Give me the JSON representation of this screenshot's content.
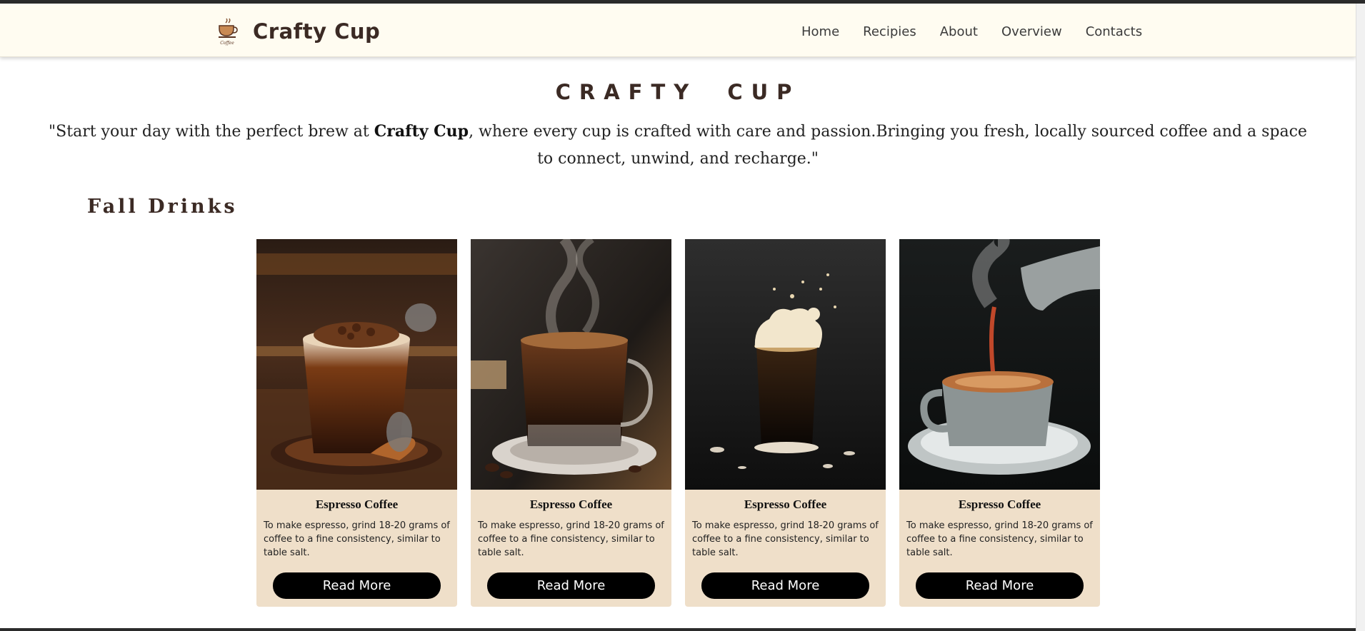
{
  "brand": {
    "name": "Crafty Cup",
    "logo_icon": "coffee-cup-logo-icon"
  },
  "nav": {
    "items": [
      "Home",
      "Recipies",
      "About",
      "Overview",
      "Contacts"
    ]
  },
  "hero": {
    "title": "CRAFTY CUP",
    "tagline_before": "\"Start your day with the perfect brew at ",
    "tagline_bold": "Crafty Cup",
    "tagline_after": ", where every cup is crafted with care and passion.Bringing you fresh, locally sourced coffee and a space to connect, unwind, and recharge.\""
  },
  "section": {
    "title": "Fall Drinks"
  },
  "cards": [
    {
      "title": "Espresso Coffee",
      "text": "To make espresso, grind 18-20 grams of coffee to a fine consistency, similar to table salt.",
      "button": "Read More",
      "image_icon": "iced-coffee-photo"
    },
    {
      "title": "Espresso Coffee",
      "text": "To make espresso, grind 18-20 grams of coffee to a fine consistency, similar to table salt.",
      "button": "Read More",
      "image_icon": "steaming-coffee-mug-photo"
    },
    {
      "title": "Espresso Coffee",
      "text": "To make espresso, grind 18-20 grams of coffee to a fine consistency, similar to table salt.",
      "button": "Read More",
      "image_icon": "foamy-cold-brew-photo"
    },
    {
      "title": "Espresso Coffee",
      "text": "To make espresso, grind 18-20 grams of coffee to a fine consistency, similar to table salt.",
      "button": "Read More",
      "image_icon": "coffee-pour-photo"
    }
  ],
  "colors": {
    "navbar_bg": "#fffcf1",
    "card_bg": "#efdfc9",
    "heading": "#3b2a24",
    "button_bg": "#000000"
  }
}
